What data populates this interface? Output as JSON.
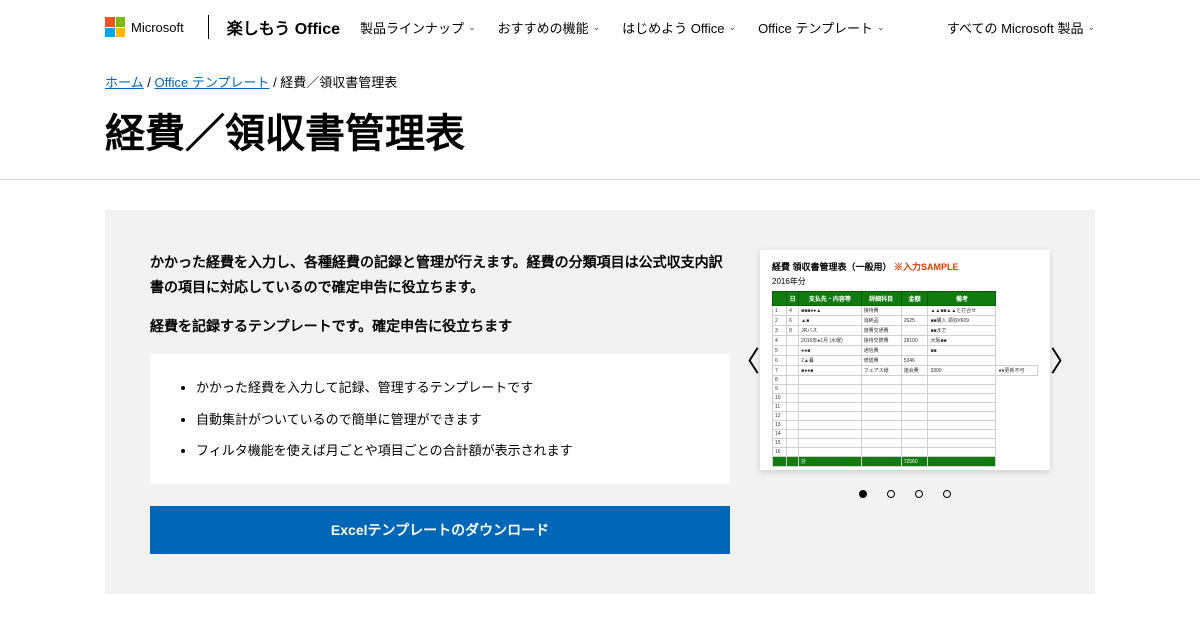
{
  "header": {
    "ms_label": "Microsoft",
    "brand": "楽しもう Office",
    "nav": [
      "製品ラインナップ",
      "おすすめの機能",
      "はじめよう Office",
      "Office テンプレート"
    ],
    "all_products": "すべての Microsoft 製品"
  },
  "breadcrumb": {
    "home": "ホーム",
    "templates": "Office テンプレート",
    "current": "経費／領収書管理表"
  },
  "page_title": "経費／領収書管理表",
  "panel": {
    "description": "かかった経費を入力し、各種経費の記録と管理が行えます。経費の分類項目は公式収支内訳書の項目に対応しているので確定申告に役立ちます。",
    "sub": "経費を記録するテンプレートです。確定申告に役立ちます",
    "bullets": [
      "かかった経費を入力して記録、管理するテンプレートです",
      "自動集計がついているので簡単に管理ができます",
      "フィルタ機能を使えば月ごとや項目ごとの合計額が表示されます"
    ],
    "download_label": "Excelテンプレートのダウンロード"
  },
  "preview": {
    "title_main": "経費 領収書管理表（一般用）",
    "title_sample": "※入力SAMPLE",
    "year": "2016年分",
    "headers": [
      "",
      "日",
      "支払先・内容等",
      "詳細科目",
      "金額",
      "備考"
    ],
    "rows": [
      [
        "1",
        "4",
        "■■■●●▲",
        "接待費",
        "",
        "▲▲■■▲▲と打合せ"
      ],
      [
        "2",
        "6",
        "▲■",
        "消耗品",
        "2625",
        "■■購入 領収#609"
      ],
      [
        "3",
        "8",
        "JRバス",
        "旅費交通費",
        "",
        "■■まで"
      ],
      [
        "4",
        "",
        "2016年●1月 (水曜)",
        "接待交際費",
        "28100",
        "大阪■■"
      ],
      [
        "5",
        "",
        "●●■",
        "通信費",
        "",
        "■■"
      ],
      [
        "6",
        "",
        "2▲暮",
        "修繕費",
        "5346",
        ""
      ],
      [
        "7",
        "",
        "■●●■",
        "フェアス様",
        "諸会費",
        "3300",
        "●●更新不可"
      ],
      [
        "8",
        "",
        "",
        "",
        "",
        ""
      ],
      [
        "9",
        "",
        "",
        "",
        "",
        ""
      ],
      [
        "10",
        "",
        "",
        "",
        "",
        ""
      ],
      [
        "11",
        "",
        "",
        "",
        "",
        ""
      ],
      [
        "12",
        "",
        "",
        "",
        "",
        ""
      ],
      [
        "13",
        "",
        "",
        "",
        "",
        ""
      ],
      [
        "14",
        "",
        "",
        "",
        "",
        ""
      ],
      [
        "15",
        "",
        "",
        "",
        "",
        ""
      ],
      [
        "16",
        "",
        "",
        "",
        "",
        ""
      ]
    ],
    "total_label": "計",
    "total_value": "72560"
  }
}
